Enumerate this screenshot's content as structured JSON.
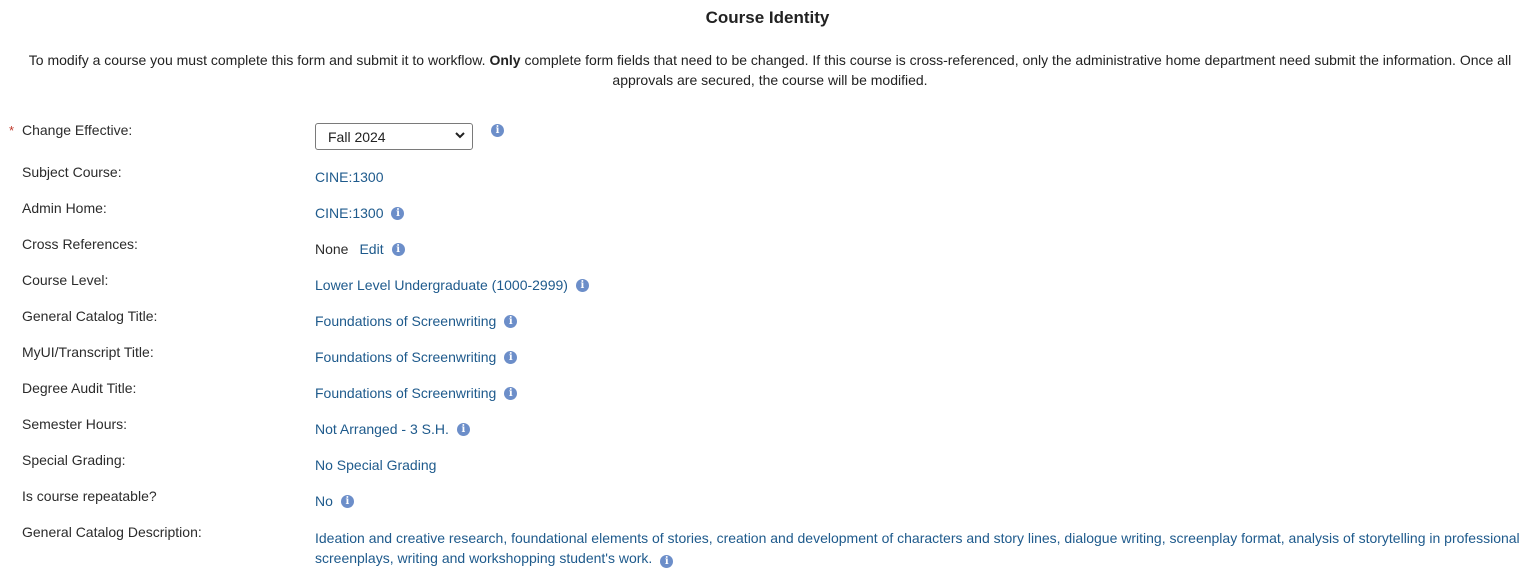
{
  "page": {
    "title": "Course Identity",
    "intro_pre": "To modify a course you must complete this form and submit it to workflow. ",
    "intro_bold": "Only",
    "intro_post": " complete form fields that need to be changed. If this course is cross-referenced, only the administrative home department need submit the information. Once all approvals are secured, the course will be modified."
  },
  "fields": {
    "change_effective": {
      "label": "Change Effective:",
      "required_mark": "*",
      "selected": "Fall 2024"
    },
    "subject_course": {
      "label": "Subject Course:",
      "value": "CINE:1300"
    },
    "admin_home": {
      "label": "Admin Home:",
      "value": "CINE:1300"
    },
    "cross_references": {
      "label": "Cross References:",
      "value": "None",
      "edit_label": "Edit"
    },
    "course_level": {
      "label": "Course Level:",
      "value": "Lower Level Undergraduate (1000-2999)"
    },
    "general_catalog_title": {
      "label": "General Catalog Title:",
      "value": "Foundations of Screenwriting"
    },
    "myui_transcript_title": {
      "label": "MyUI/Transcript Title:",
      "value": "Foundations of Screenwriting"
    },
    "degree_audit_title": {
      "label": "Degree Audit Title:",
      "value": "Foundations of Screenwriting"
    },
    "semester_hours": {
      "label": "Semester Hours:",
      "value": "Not Arranged - 3 S.H."
    },
    "special_grading": {
      "label": "Special Grading:",
      "value": "No Special Grading"
    },
    "repeatable": {
      "label": "Is course repeatable?",
      "value": "No"
    },
    "general_catalog_description": {
      "label": "General Catalog Description:",
      "value": "Ideation and creative research, foundational elements of stories, creation and development of characters and story lines, dialogue writing, screenplay format, analysis of storytelling in professional screenplays, writing and workshopping student's work."
    }
  },
  "icons": {
    "info": "i",
    "info_color": "#6c8ec9",
    "link_color": "#1e5a8c",
    "required_color": "#c0392b"
  }
}
